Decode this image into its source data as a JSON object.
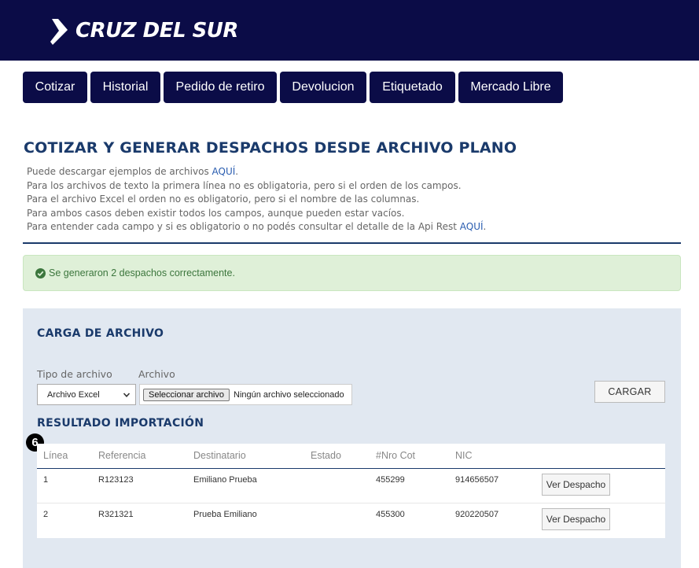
{
  "header": {
    "logo_text": "CRUZ DEL SUR",
    "logo_icon": "arrow-logo-icon"
  },
  "nav": [
    {
      "label": "Cotizar"
    },
    {
      "label": "Historial"
    },
    {
      "label": "Pedido de retiro"
    },
    {
      "label": "Devolucion"
    },
    {
      "label": "Etiquetado"
    },
    {
      "label": "Mercado Libre"
    }
  ],
  "page": {
    "title": "COTIZAR Y GENERAR DESPACHOS DESDE ARCHIVO PLANO",
    "info": {
      "line1_pre": "Puede descargar ejemplos de archivos ",
      "line1_link": "AQUÍ",
      "line1_post": ".",
      "line2": "Para los archivos de texto la primera línea no es obligatoria, pero si el orden de los campos.",
      "line3": "Para el archivo Excel el orden no es obligatorio, pero si el nombre de las columnas.",
      "line4": "Para ambos casos deben existir todos los campos, aunque pueden estar vacíos.",
      "line5_pre": "Para entender cada campo y si es obligatorio o no podés consultar el detalle de la Api Rest ",
      "line5_link": "AQUÍ",
      "line5_post": "."
    }
  },
  "alert": {
    "text": "Se generaron 2 despachos correctamente.",
    "icon": "check-circle-icon",
    "color": "#3c763d"
  },
  "upload": {
    "title": "CARGA DE ARCHIVO",
    "type_label": "Tipo de archivo",
    "type_value": "Archivo Excel",
    "file_label": "Archivo",
    "file_button": "Seleccionar archivo",
    "file_status": "Ningún archivo seleccionado",
    "submit_label": "CARGAR"
  },
  "results": {
    "title": "RESULTADO IMPORTACIÓN",
    "badge": "6",
    "columns": [
      "Línea",
      "Referencia",
      "Destinatario",
      "Estado",
      "#Nro Cot",
      "NIC"
    ],
    "rows": [
      {
        "linea": "1",
        "referencia": "R123123",
        "destinatario": "Emiliano Prueba",
        "estado": "",
        "nro_cot": "455299",
        "nic": "914656507",
        "action": "Ver Despacho"
      },
      {
        "linea": "2",
        "referencia": "R321321",
        "destinatario": "Prueba Emiliano",
        "estado": "",
        "nro_cot": "455300",
        "nic": "920220507",
        "action": "Ver Despacho"
      }
    ]
  },
  "colors": {
    "brand_navy": "#0b0c47",
    "title_blue": "#1a3a6b",
    "panel_bg": "#e1e8f1",
    "link_blue": "#2a5db0"
  }
}
